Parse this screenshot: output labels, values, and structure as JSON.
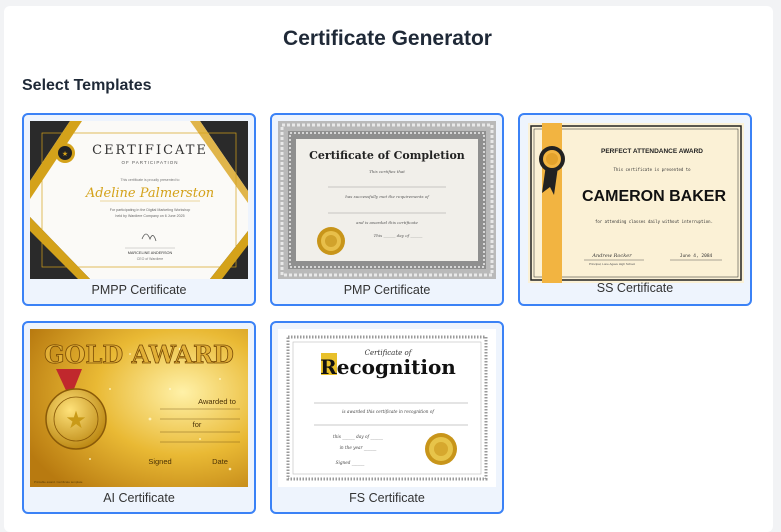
{
  "app": {
    "title": "Certificate Generator"
  },
  "section": {
    "label": "Select Templates"
  },
  "templates": [
    {
      "caption": "PMPP Certificate",
      "heading": "CERTIFICATE",
      "subheading": "OF PARTICIPATION",
      "intro": "This certificate is proudly presented to",
      "recipient": "Adeline Palmerston",
      "body": [
        "For participating in the Digital Marketing Workshop",
        "held by Wardiere Company on 6 June 2025"
      ],
      "signer": "MARCELINE ANDERSON",
      "signer_title": "CEO of Wardiere"
    },
    {
      "caption": "PMP Certificate",
      "heading": "Certificate of Completion",
      "lines": [
        "This certifies that",
        "has successfully met the requirements of",
        "and is awarded this certificate",
        "This ______ day of ______"
      ]
    },
    {
      "caption": "SS Certificate",
      "heading": "PERFECT ATTENDANCE AWARD",
      "intro": "This certificate is presented to",
      "recipient": "CAMERON BAKER",
      "body": "for attending classes daily without interruption.",
      "signer": "Andrew Rocker",
      "signer_title": "Principal, Lone Agave High School",
      "date": "June 4, 2084"
    },
    {
      "caption": "AI Certificate",
      "heading": "GOLD AWARD",
      "awarded_to": "Awarded to",
      "for": "for",
      "signed": "Signed",
      "date_label": "Date",
      "footer": "Printable award. Certificate template"
    },
    {
      "caption": "FS Certificate",
      "heading_small": "Certificate of",
      "heading_big": "Recognition",
      "lines": [
        "is awarded this certificate in recognition of",
        "this ______ day of ______",
        "in the year ______",
        "Signed ______"
      ]
    }
  ],
  "colors": {
    "accent": "#3b82f6",
    "card_bg": "#eef4fd",
    "gold": "#d4a21a",
    "ribbon": "#f2b441"
  }
}
